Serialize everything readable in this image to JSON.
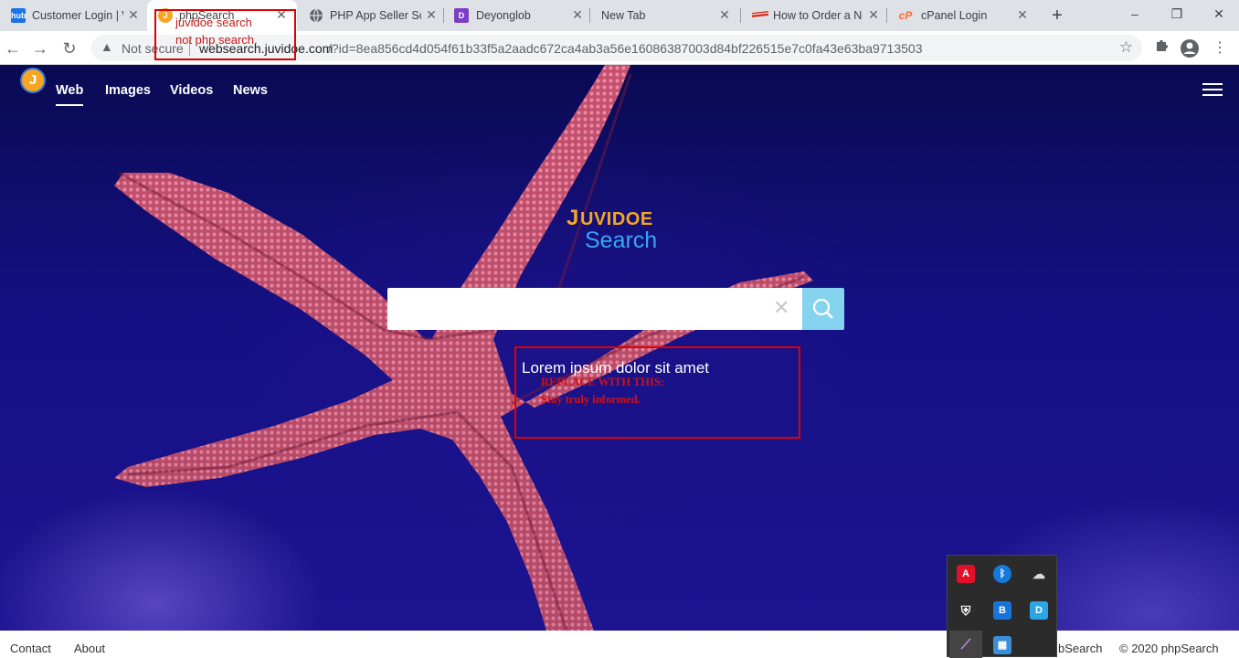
{
  "browser": {
    "tabs": [
      {
        "title": "Customer Login | W",
        "favicon": "hub",
        "favicon_color": "#1a73e8",
        "active": false
      },
      {
        "title": "phpSearch",
        "favicon": "J",
        "favicon_color": "#f5a623",
        "active": true
      },
      {
        "title": "PHP App Seller Sc",
        "favicon": "globe-icon",
        "favicon_color": "#5f6368",
        "active": false
      },
      {
        "title": "Deyonglob",
        "favicon": "D",
        "favicon_color": "#7b3fc4",
        "active": false
      },
      {
        "title": "New Tab",
        "favicon": "",
        "favicon_color": "#dee1e6",
        "active": false
      },
      {
        "title": "How to Order a Ne",
        "favicon": "flag-icon",
        "favicon_color": "#d93025",
        "active": false
      },
      {
        "title": "cPanel Login",
        "favicon": "cP",
        "favicon_color": "#ff6c2c",
        "active": false
      }
    ],
    "new_tab": "+",
    "window_controls": {
      "minimize": "–",
      "maximize": "❐",
      "close": "✕"
    },
    "security_label": "Not secure",
    "url_host": "websearch.juvidoe.com",
    "url_path": "/?id=8ea856cd4d054f61b33f5a2aadc672ca4ab3a56e16086387003d84bf226515e7c0fa43e63ba9713503"
  },
  "page": {
    "logo_letter": "J",
    "nav": [
      {
        "label": "Web",
        "active": true
      },
      {
        "label": "Images",
        "active": false
      },
      {
        "label": "Videos",
        "active": false
      },
      {
        "label": "News",
        "active": false
      }
    ],
    "brand_line1": "UVIDOE",
    "brand_j": "J",
    "brand_line2": "Search",
    "search": {
      "value": "",
      "placeholder": ""
    },
    "tagline": "Lorem ipsum dolor sit amet"
  },
  "annotations": {
    "tab_note_line1": "juvidoe search",
    "tab_note_line2": "not php search.",
    "replace_line1": "REPLACE WITH THIS:",
    "replace_line2": "Stay truly informed.",
    "box_color": "#e00000"
  },
  "footer": {
    "links": [
      "Contact",
      "About"
    ],
    "right_partial": "bSearch",
    "copyright": "© 2020 phpSearch"
  },
  "tray": {
    "icons": [
      "adobe-icon",
      "bluetooth-icon",
      "cloud-off-icon",
      "security-shield-icon",
      "b-app-icon",
      "d-app-icon",
      "feather-icon",
      "network-icon"
    ]
  }
}
